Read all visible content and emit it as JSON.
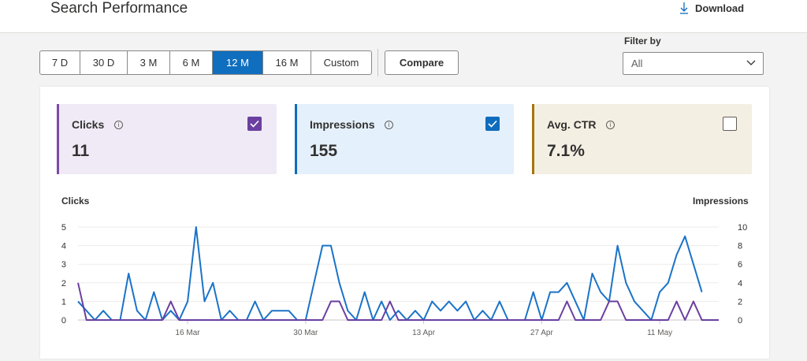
{
  "header": {
    "title": "Search Performance",
    "download_label": "Download"
  },
  "toolbar": {
    "ranges": [
      "7 D",
      "30 D",
      "3 M",
      "6 M",
      "12 M",
      "16 M",
      "Custom"
    ],
    "active_range": "12 M",
    "compare_label": "Compare"
  },
  "filter": {
    "label": "Filter by",
    "value": "All"
  },
  "metrics": [
    {
      "name": "Clicks",
      "value": "11",
      "checked": true,
      "bg": "#efeaf5",
      "accent": "#7b4aa9",
      "check_color": "#6b3fa0"
    },
    {
      "name": "Impressions",
      "value": "155",
      "checked": true,
      "bg": "#e4f0fb",
      "accent": "#0f6cbd",
      "check_color": "#0f6cbd"
    },
    {
      "name": "Avg. CTR",
      "value": "7.1%",
      "checked": false,
      "bg": "#f4efe3",
      "accent": "#a6750b",
      "check_color": "#605e5c"
    }
  ],
  "chart_data": {
    "type": "line",
    "left_axis_label": "Clicks",
    "right_axis_label": "Impressions",
    "left_ticks": [
      "0",
      "1",
      "2",
      "3",
      "4",
      "5"
    ],
    "right_ticks": [
      "0",
      "2",
      "4",
      "6",
      "8",
      "10"
    ],
    "left_ylim": [
      0,
      5
    ],
    "right_ylim": [
      0,
      10
    ],
    "x_ticks": [
      {
        "label": "16 Mar",
        "index": 13
      },
      {
        "label": "30 Mar",
        "index": 27
      },
      {
        "label": "13 Apr",
        "index": 41
      },
      {
        "label": "27 Apr",
        "index": 55
      },
      {
        "label": "11 May",
        "index": 69
      }
    ],
    "series": [
      {
        "name": "Clicks",
        "axis": "left",
        "color": "#6b3fa0",
        "values": [
          2,
          0,
          0,
          0,
          0,
          0,
          0,
          0,
          0,
          0,
          0,
          1,
          0,
          0,
          0,
          0,
          0,
          0,
          0,
          0,
          0,
          0,
          0,
          0,
          0,
          0,
          0,
          0,
          0,
          0,
          1,
          1,
          0,
          0,
          0,
          0,
          0,
          1,
          0,
          0,
          0,
          0,
          0,
          0,
          0,
          0,
          0,
          0,
          0,
          0,
          0,
          0,
          0,
          0,
          0,
          0,
          0,
          0,
          1,
          0,
          0,
          0,
          0,
          1,
          1,
          0,
          0,
          0,
          0,
          0,
          0,
          1,
          0,
          1,
          0,
          0,
          0
        ]
      },
      {
        "name": "Impressions",
        "axis": "right",
        "color": "#1a73c8",
        "values": [
          2,
          1,
          0,
          1,
          0,
          0,
          5,
          1,
          0,
          3,
          0,
          1,
          0,
          2,
          10,
          2,
          4,
          0,
          1,
          0,
          0,
          2,
          0,
          1,
          1,
          1,
          0,
          0,
          4,
          8,
          8,
          4,
          1,
          0,
          3,
          0,
          2,
          0,
          1,
          0,
          1,
          0,
          2,
          1,
          2,
          1,
          2,
          0,
          1,
          0,
          2,
          0,
          0,
          0,
          3,
          0,
          3,
          3,
          4,
          2,
          0,
          5,
          3,
          2,
          8,
          4,
          2,
          1,
          0,
          3,
          4,
          7,
          9,
          6,
          3
        ]
      }
    ]
  }
}
